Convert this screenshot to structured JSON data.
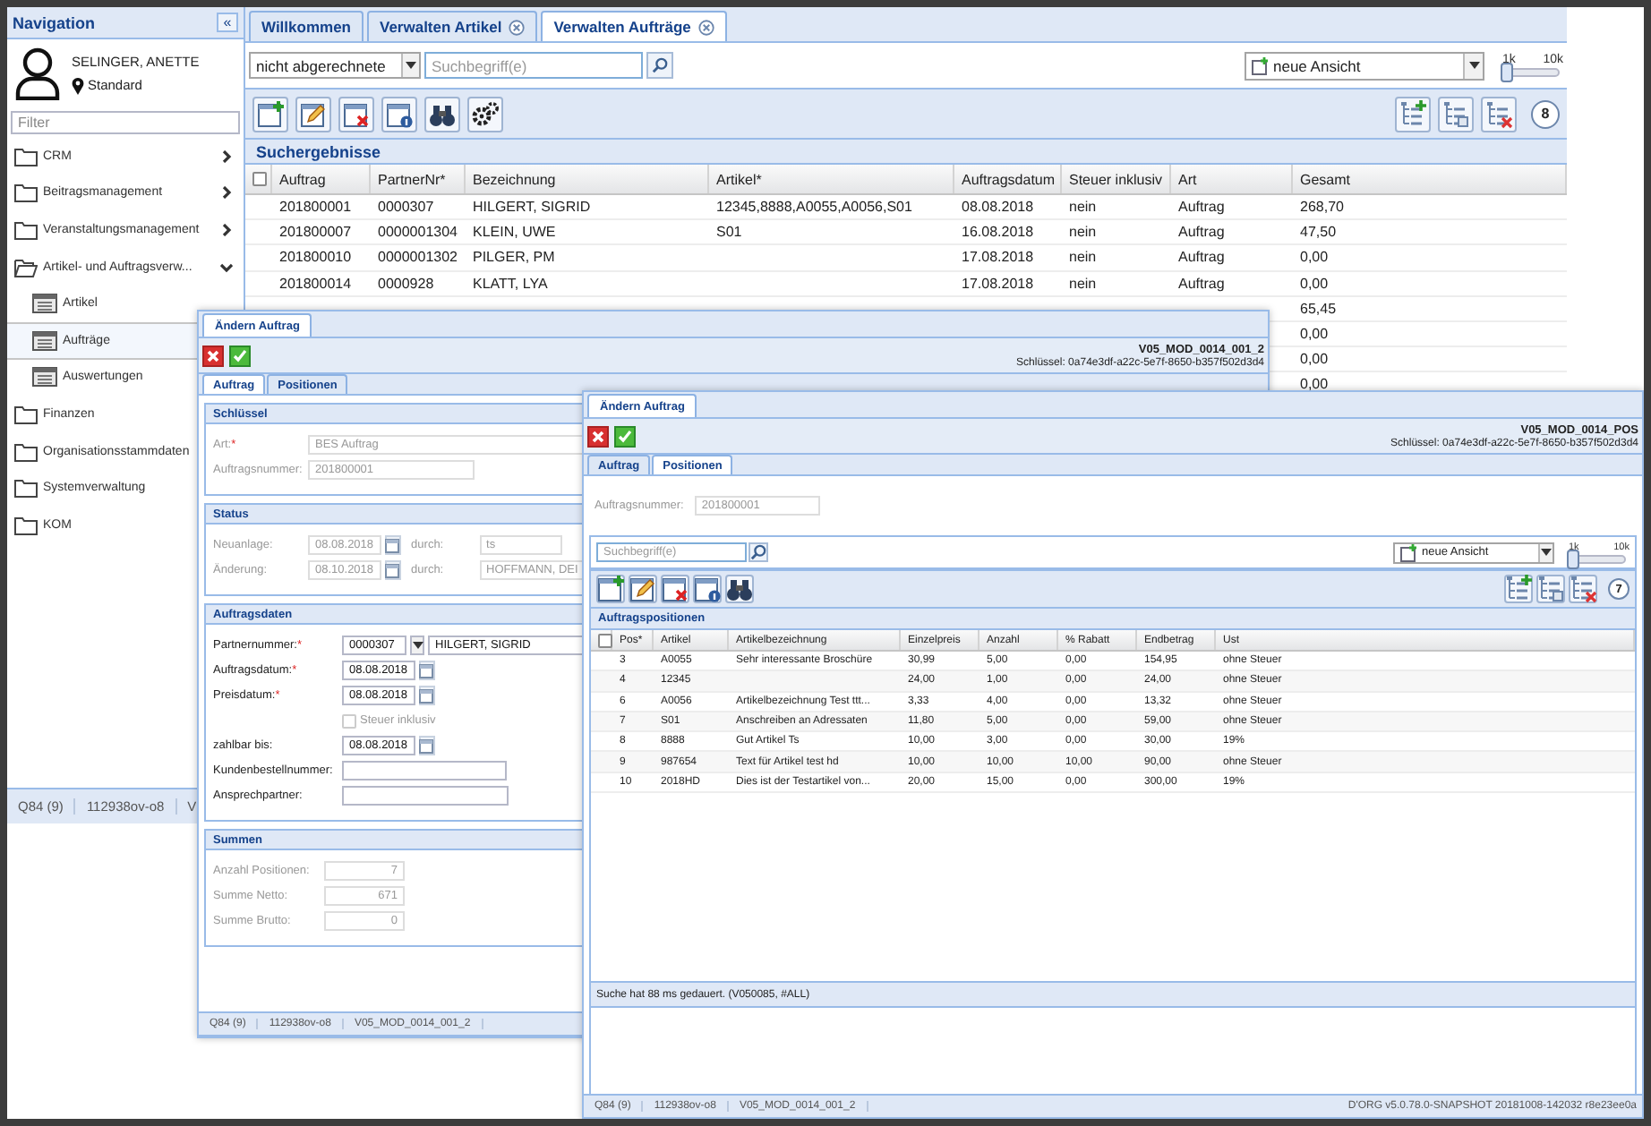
{
  "nav": {
    "title": "Navigation",
    "collapse": "«",
    "user": {
      "name": "SELINGER, ANETTE",
      "location": "Standard"
    },
    "filter": {
      "placeholder": "Filter"
    },
    "items": [
      {
        "label": "CRM",
        "expanded": false,
        "selected": false
      },
      {
        "label": "Beitragsmanagement",
        "expanded": false,
        "selected": false
      },
      {
        "label": "Veranstaltungsmanagement",
        "expanded": false,
        "selected": false
      },
      {
        "label": "Artikel- und Auftragsverw...",
        "expanded": true,
        "selected": false,
        "children": [
          {
            "label": "Artikel",
            "selected": false
          },
          {
            "label": "Aufträge",
            "selected": true
          },
          {
            "label": "Auswertungen",
            "selected": false
          }
        ]
      },
      {
        "label": "Finanzen",
        "selected": false
      },
      {
        "label": "Organisationsstammdaten",
        "selected": false
      },
      {
        "label": "Systemverwaltung",
        "selected": false
      },
      {
        "label": "KOM",
        "selected": false
      }
    ],
    "status": [
      "Q84 (9)",
      "112938ov-o8",
      "V"
    ]
  },
  "main": {
    "tabs": [
      {
        "label": "Willkommen",
        "closable": false,
        "selected": false
      },
      {
        "label": "Verwalten Artikel",
        "closable": true,
        "selected": false
      },
      {
        "label": "Verwalten Aufträge",
        "closable": true,
        "selected": true
      }
    ],
    "filter": {
      "value": "nicht abgerechnete"
    },
    "search": {
      "placeholder": "Suchbegriff(e)"
    },
    "view": {
      "value": "neue Ansicht"
    },
    "slider": {
      "min": "1k",
      "max": "10k",
      "level": 0
    },
    "count": "8",
    "section": "Suchergebnisse",
    "table": {
      "select_all": {
        "checked": false
      },
      "columns": [
        "Auftrag",
        "PartnerNr*",
        "Bezeichnung",
        "Artikel*",
        "Auftragsdatum",
        "Steuer inklusiv",
        "Art",
        "Gesamt"
      ],
      "rows": [
        {
          "cells": [
            "201800001",
            "0000307",
            "HILGERT, SIGRID",
            "12345,8888,A0055,A0056,S01",
            "08.08.2018",
            "nein",
            "Auftrag",
            "268,70"
          ]
        },
        {
          "cells": [
            "201800007",
            "0000001304",
            "KLEIN, UWE",
            "S01",
            "16.08.2018",
            "nein",
            "Auftrag",
            "47,50"
          ]
        },
        {
          "cells": [
            "201800010",
            "0000001302",
            "PILGER, PM",
            null,
            "17.08.2018",
            "nein",
            "Auftrag",
            "0,00"
          ]
        },
        {
          "cells": [
            "201800014",
            "0000928",
            "KLATT, LYA",
            null,
            "17.08.2018",
            "nein",
            "Auftrag",
            "0,00"
          ]
        },
        {
          "cells": [
            null,
            null,
            null,
            null,
            null,
            null,
            null,
            "65,45"
          ]
        },
        {
          "cells": [
            null,
            null,
            null,
            null,
            null,
            null,
            null,
            "0,00"
          ]
        },
        {
          "cells": [
            null,
            null,
            null,
            null,
            null,
            null,
            null,
            "0,00"
          ]
        },
        {
          "cells": [
            null,
            null,
            null,
            null,
            null,
            null,
            null,
            "0,00"
          ]
        }
      ]
    }
  },
  "dialog_order": {
    "tab": "Ändern Auftrag",
    "code": "V05_MOD_0014_001_2",
    "key": "Schlüssel: 0a74e3df-a22c-5e7f-8650-b357f502d3d4",
    "tabs": [
      {
        "label": "Auftrag",
        "selected": true
      },
      {
        "label": "Positionen",
        "selected": false
      }
    ],
    "sections": [
      {
        "title": "Schlüssel",
        "fields": [
          {
            "kind": "text",
            "label": "Art:",
            "mark": "*",
            "value": "BES Auftrag",
            "disabled": true
          },
          {
            "kind": "text",
            "label": "Auftragsnummer:",
            "value": "201800001",
            "disabled": true
          }
        ]
      },
      {
        "title": "Status",
        "fields": [
          {
            "kind": "date-by",
            "label": "Neuanlage:",
            "value": "08.08.2018",
            "by_label": "durch:",
            "by_value": "ts",
            "disabled": true
          },
          {
            "kind": "date-by",
            "label": "Änderung:",
            "value": "08.10.2018",
            "by_label": "durch:",
            "by_value": "HOFFMANN, DEI",
            "disabled": true
          }
        ]
      },
      {
        "title": "Auftragsdaten",
        "fields": [
          {
            "kind": "partner",
            "label": "Partnernummer:",
            "mark": "*",
            "value": "0000307",
            "name": "HILGERT, SIGRID",
            "disabled": false
          },
          {
            "kind": "date",
            "label": "Auftragsdatum:",
            "mark": "*",
            "value": "08.08.2018",
            "disabled": false
          },
          {
            "kind": "date",
            "label": "Preisdatum:",
            "mark": "*",
            "value": "08.08.2018",
            "disabled": false
          },
          {
            "kind": "checkbox",
            "label": "Steuer inklusiv",
            "checked": false,
            "disabled": true
          },
          {
            "kind": "date",
            "label": "zahlbar bis:",
            "value": "08.08.2018",
            "disabled": false
          },
          {
            "kind": "text",
            "label": "Kundenbestellnummer:",
            "disabled": false
          },
          {
            "kind": "text",
            "label": "Ansprechpartner:",
            "disabled": false
          }
        ]
      },
      {
        "title": "Summen",
        "fields": [
          {
            "kind": "number",
            "label": "Anzahl Positionen:",
            "value": "7",
            "disabled": true
          },
          {
            "kind": "number",
            "label": "Summe Netto:",
            "value": "671",
            "disabled": true
          },
          {
            "kind": "number",
            "label": "Summe Brutto:",
            "value": "0",
            "disabled": true
          }
        ]
      }
    ],
    "status": [
      "Q84 (9)",
      "112938ov-o8",
      "V05_MOD_0014_001_2"
    ]
  },
  "dialog_positions": {
    "tab": "Ändern Auftrag",
    "code": "V05_MOD_0014_POS",
    "key": "Schlüssel: 0a74e3df-a22c-5e7f-8650-b357f502d3d4",
    "tabs": [
      {
        "label": "Auftrag",
        "selected": false
      },
      {
        "label": "Positionen",
        "selected": true
      }
    ],
    "order_number": {
      "label": "Auftragsnummer:",
      "value": "201800001"
    },
    "search": {
      "placeholder": "Suchbegriff(e)"
    },
    "view": {
      "value": "neue Ansicht"
    },
    "slider": {
      "min": "1k",
      "max": "10k",
      "level": 0
    },
    "count": "7",
    "section": "Auftragspositionen",
    "table": {
      "select_all": {
        "checked": false
      },
      "columns": [
        "Pos*",
        "Artikel",
        "Artikelbezeichnung",
        "Einzelpreis",
        "Anzahl",
        "% Rabatt",
        "Endbetrag",
        "Ust"
      ],
      "rows": [
        {
          "cells": [
            "3",
            "A0055",
            "Sehr interessante Broschüre",
            "30,99",
            "5,00",
            "0,00",
            "154,95",
            "ohne Steuer"
          ]
        },
        {
          "cells": [
            "4",
            "12345",
            null,
            "24,00",
            "1,00",
            "0,00",
            "24,00",
            "ohne Steuer"
          ]
        },
        {
          "cells": [
            "6",
            "A0056",
            "Artikelbezeichnung Test ttt...",
            "3,33",
            "4,00",
            "0,00",
            "13,32",
            "ohne Steuer"
          ]
        },
        {
          "cells": [
            "7",
            "S01",
            "Anschreiben an Adressaten",
            "11,80",
            "5,00",
            "0,00",
            "59,00",
            "ohne Steuer"
          ]
        },
        {
          "cells": [
            "8",
            "8888",
            "Gut Artikel Ts",
            "10,00",
            "3,00",
            "0,00",
            "30,00",
            "19%"
          ]
        },
        {
          "cells": [
            "9",
            "987654",
            "Text für Artikel test hd",
            "10,00",
            "10,00",
            "10,00",
            "90,00",
            "ohne Steuer"
          ]
        },
        {
          "cells": [
            "10",
            "2018HD",
            "Dies ist der Testartikel von...",
            "20,00",
            "15,00",
            "0,00",
            "300,00",
            "19%"
          ]
        }
      ]
    },
    "search_status": "Suche hat 88 ms gedauert. (V050085, #ALL)",
    "status": [
      "Q84 (9)",
      "112938ov-o8",
      "V05_MOD_0014_001_2"
    ],
    "version": "D'ORG v5.0.78.0-SNAPSHOT 20181008-142032 r8e23ee0a"
  }
}
